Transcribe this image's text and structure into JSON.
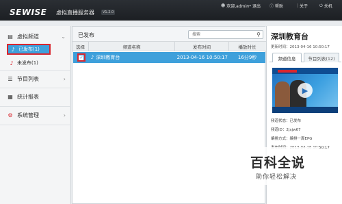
{
  "app": {
    "logo": "SEWISE",
    "name": "虚拟直播服务器",
    "version": "V1.2.0"
  },
  "topnav": {
    "user": "欢迎,admin",
    "logout": "退出",
    "help": "帮助",
    "sep": "|",
    "about": "关于",
    "close": "关机"
  },
  "sidebar": {
    "items": [
      {
        "label": "虚拟频道",
        "icon": "monitor-icon"
      },
      {
        "label": "已发布(1)",
        "icon": "music-note-icon"
      },
      {
        "label": "未发布(1)",
        "icon": "music-note-icon"
      },
      {
        "label": "节目列表",
        "icon": "list-icon"
      },
      {
        "label": "统计报表",
        "icon": "chart-icon"
      },
      {
        "label": "系统管理",
        "icon": "settings-icon"
      }
    ]
  },
  "main": {
    "title": "已发布",
    "search_placeholder": "搜索",
    "columns": [
      "选择",
      "频道名称",
      "发布时间",
      "播放时长"
    ],
    "rows": [
      {
        "name": "深圳教育台",
        "time": "2013-04-16 10:50:17",
        "duration": "16分9秒",
        "checked": "✓"
      }
    ]
  },
  "detail": {
    "title": "深圳教育台",
    "updated": "更新时间：2013-04-16 10:50:17",
    "tabs": [
      "频道信息",
      "节目列表(12)"
    ],
    "status": "频道状态：已发布",
    "address": "频道ID：2jxjw67",
    "mode": "编排方式：编排一周EPG",
    "pubtime": "发布时间：2013-04-16 10:50:17"
  },
  "watermark": {
    "big": "百科全说",
    "small": "助你轻松解决"
  },
  "colors": {
    "accent": "#3ea0db",
    "highlight": "#d9262e",
    "topbar": "#1c1f23"
  }
}
